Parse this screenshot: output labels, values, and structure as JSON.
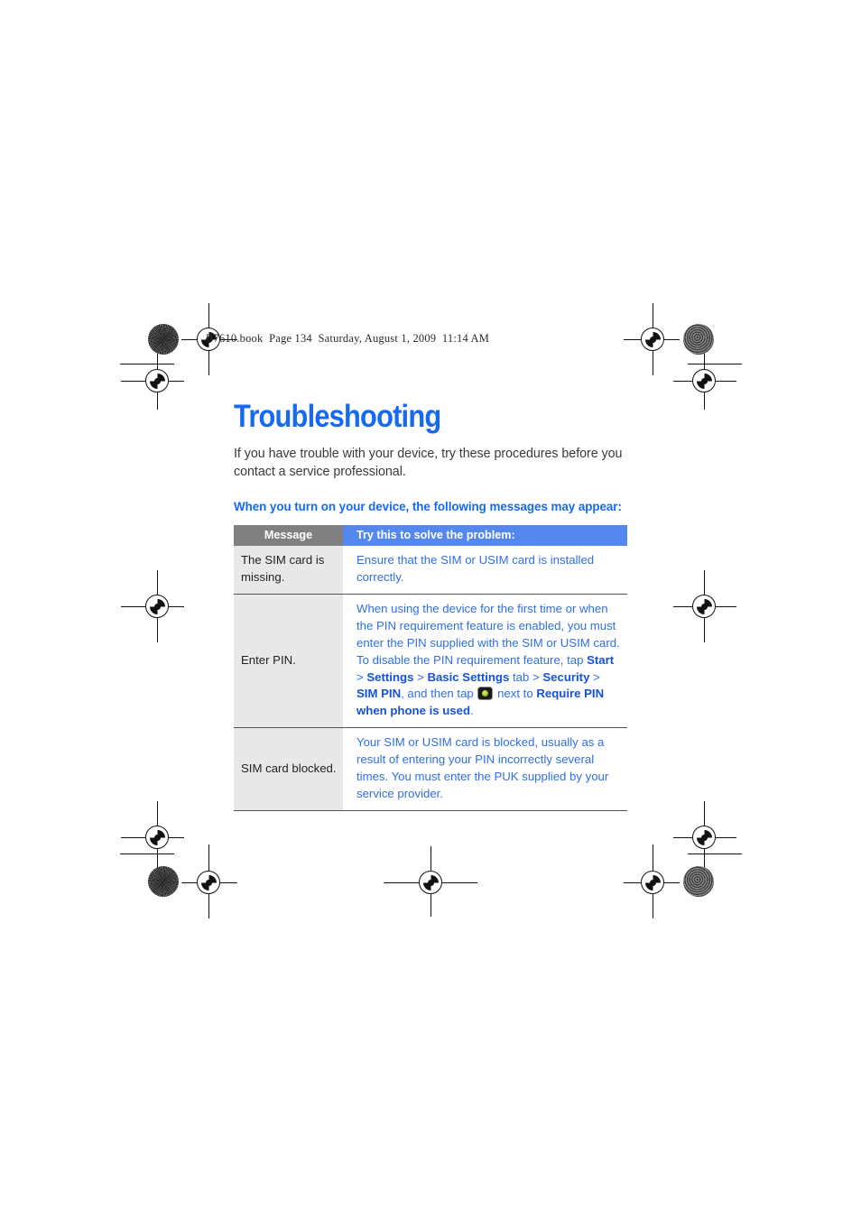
{
  "running_header": "B7610.book  Page 134  Saturday, August 1, 2009  11:14 AM",
  "document": {
    "chapter_title": "Troubleshooting",
    "intro": "If you have trouble with your device, try these procedures before you contact a service professional.",
    "subheading": "When you turn on your device, the following messages may appear:"
  },
  "table": {
    "headers": {
      "message": "Message",
      "solution": "Try this to solve the problem:"
    },
    "rows": [
      {
        "message": "The SIM card is missing.",
        "solution": "Ensure that the SIM or USIM card is installed correctly."
      },
      {
        "message": "Enter PIN.",
        "solution_parts": [
          {
            "text": "When using the device for the first time or when the PIN requirement feature is enabled, you must enter the PIN supplied with the SIM or USIM card. To disable the PIN requirement feature, tap ",
            "bold": false
          },
          {
            "text": "Start",
            "bold": true
          },
          {
            "text": " > ",
            "bold": false
          },
          {
            "text": "Settings",
            "bold": true
          },
          {
            "text": " > ",
            "bold": false
          },
          {
            "text": "Basic Settings",
            "bold": true
          },
          {
            "text": " tab > ",
            "bold": false
          },
          {
            "text": "Security",
            "bold": true
          },
          {
            "text": " > ",
            "bold": false
          },
          {
            "text": "SIM PIN",
            "bold": true
          },
          {
            "text": ", and then tap ",
            "bold": false
          },
          {
            "icon": "toggle-switch-icon"
          },
          {
            "text": " next to ",
            "bold": false
          },
          {
            "text": "Require PIN when phone is used",
            "bold": true
          },
          {
            "text": ".",
            "bold": false
          }
        ]
      },
      {
        "message": "SIM card blocked.",
        "solution": "Your SIM or USIM card is blocked, usually as a result of entering your PIN incorrectly several times. You must enter the PUK supplied by your service provider."
      }
    ]
  },
  "colors": {
    "accent_blue": "#1669f2",
    "header_blue": "#5588ee",
    "header_gray": "#808080",
    "key_cell_bg": "#e8e8e8",
    "body_blue": "#2f6fe4",
    "bold_blue": "#1452d8",
    "body_text": "#3a3a3a"
  }
}
